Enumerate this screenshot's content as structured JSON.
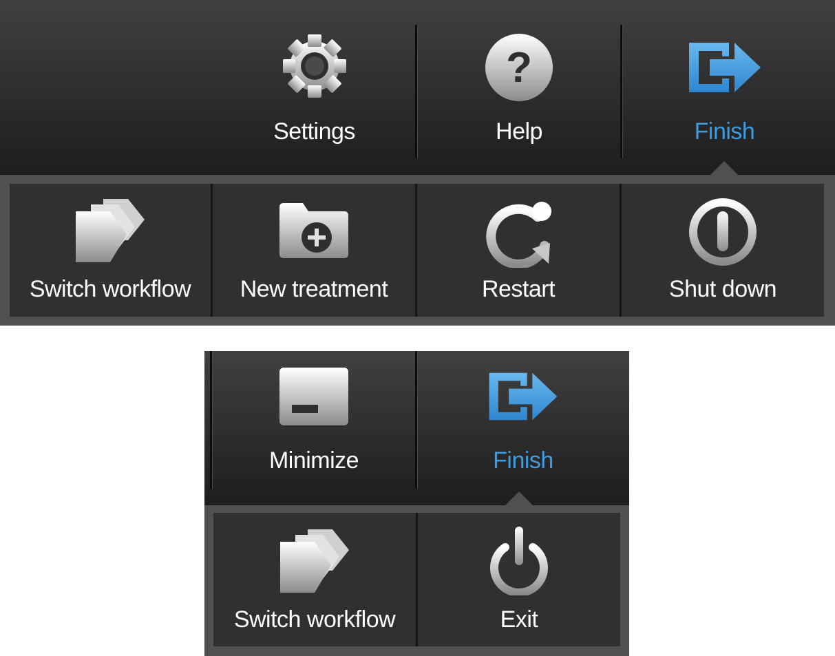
{
  "colors": {
    "accent": "#3d9be0",
    "panel_border": "#505050",
    "drawer_bg": "#303030",
    "text": "#ffffff"
  },
  "menu_desktop": {
    "toolbar": [
      {
        "label": "Settings",
        "icon": "gear-icon"
      },
      {
        "label": "Help",
        "icon": "help-icon"
      },
      {
        "label": "Finish",
        "icon": "finish-exit-icon",
        "active": true
      }
    ],
    "drawer": [
      {
        "label": "Switch workflow",
        "icon": "stacked-documents-icon"
      },
      {
        "label": "New treatment",
        "icon": "folder-add-icon"
      },
      {
        "label": "Restart",
        "icon": "restart-icon"
      },
      {
        "label": "Shut down",
        "icon": "shutdown-icon"
      }
    ]
  },
  "menu_compact": {
    "toolbar": [
      {
        "label": "Minimize",
        "icon": "minimize-icon"
      },
      {
        "label": "Finish",
        "icon": "finish-exit-icon",
        "active": true
      }
    ],
    "drawer": [
      {
        "label": "Switch workflow",
        "icon": "stacked-documents-icon"
      },
      {
        "label": "Exit",
        "icon": "power-icon"
      }
    ]
  }
}
